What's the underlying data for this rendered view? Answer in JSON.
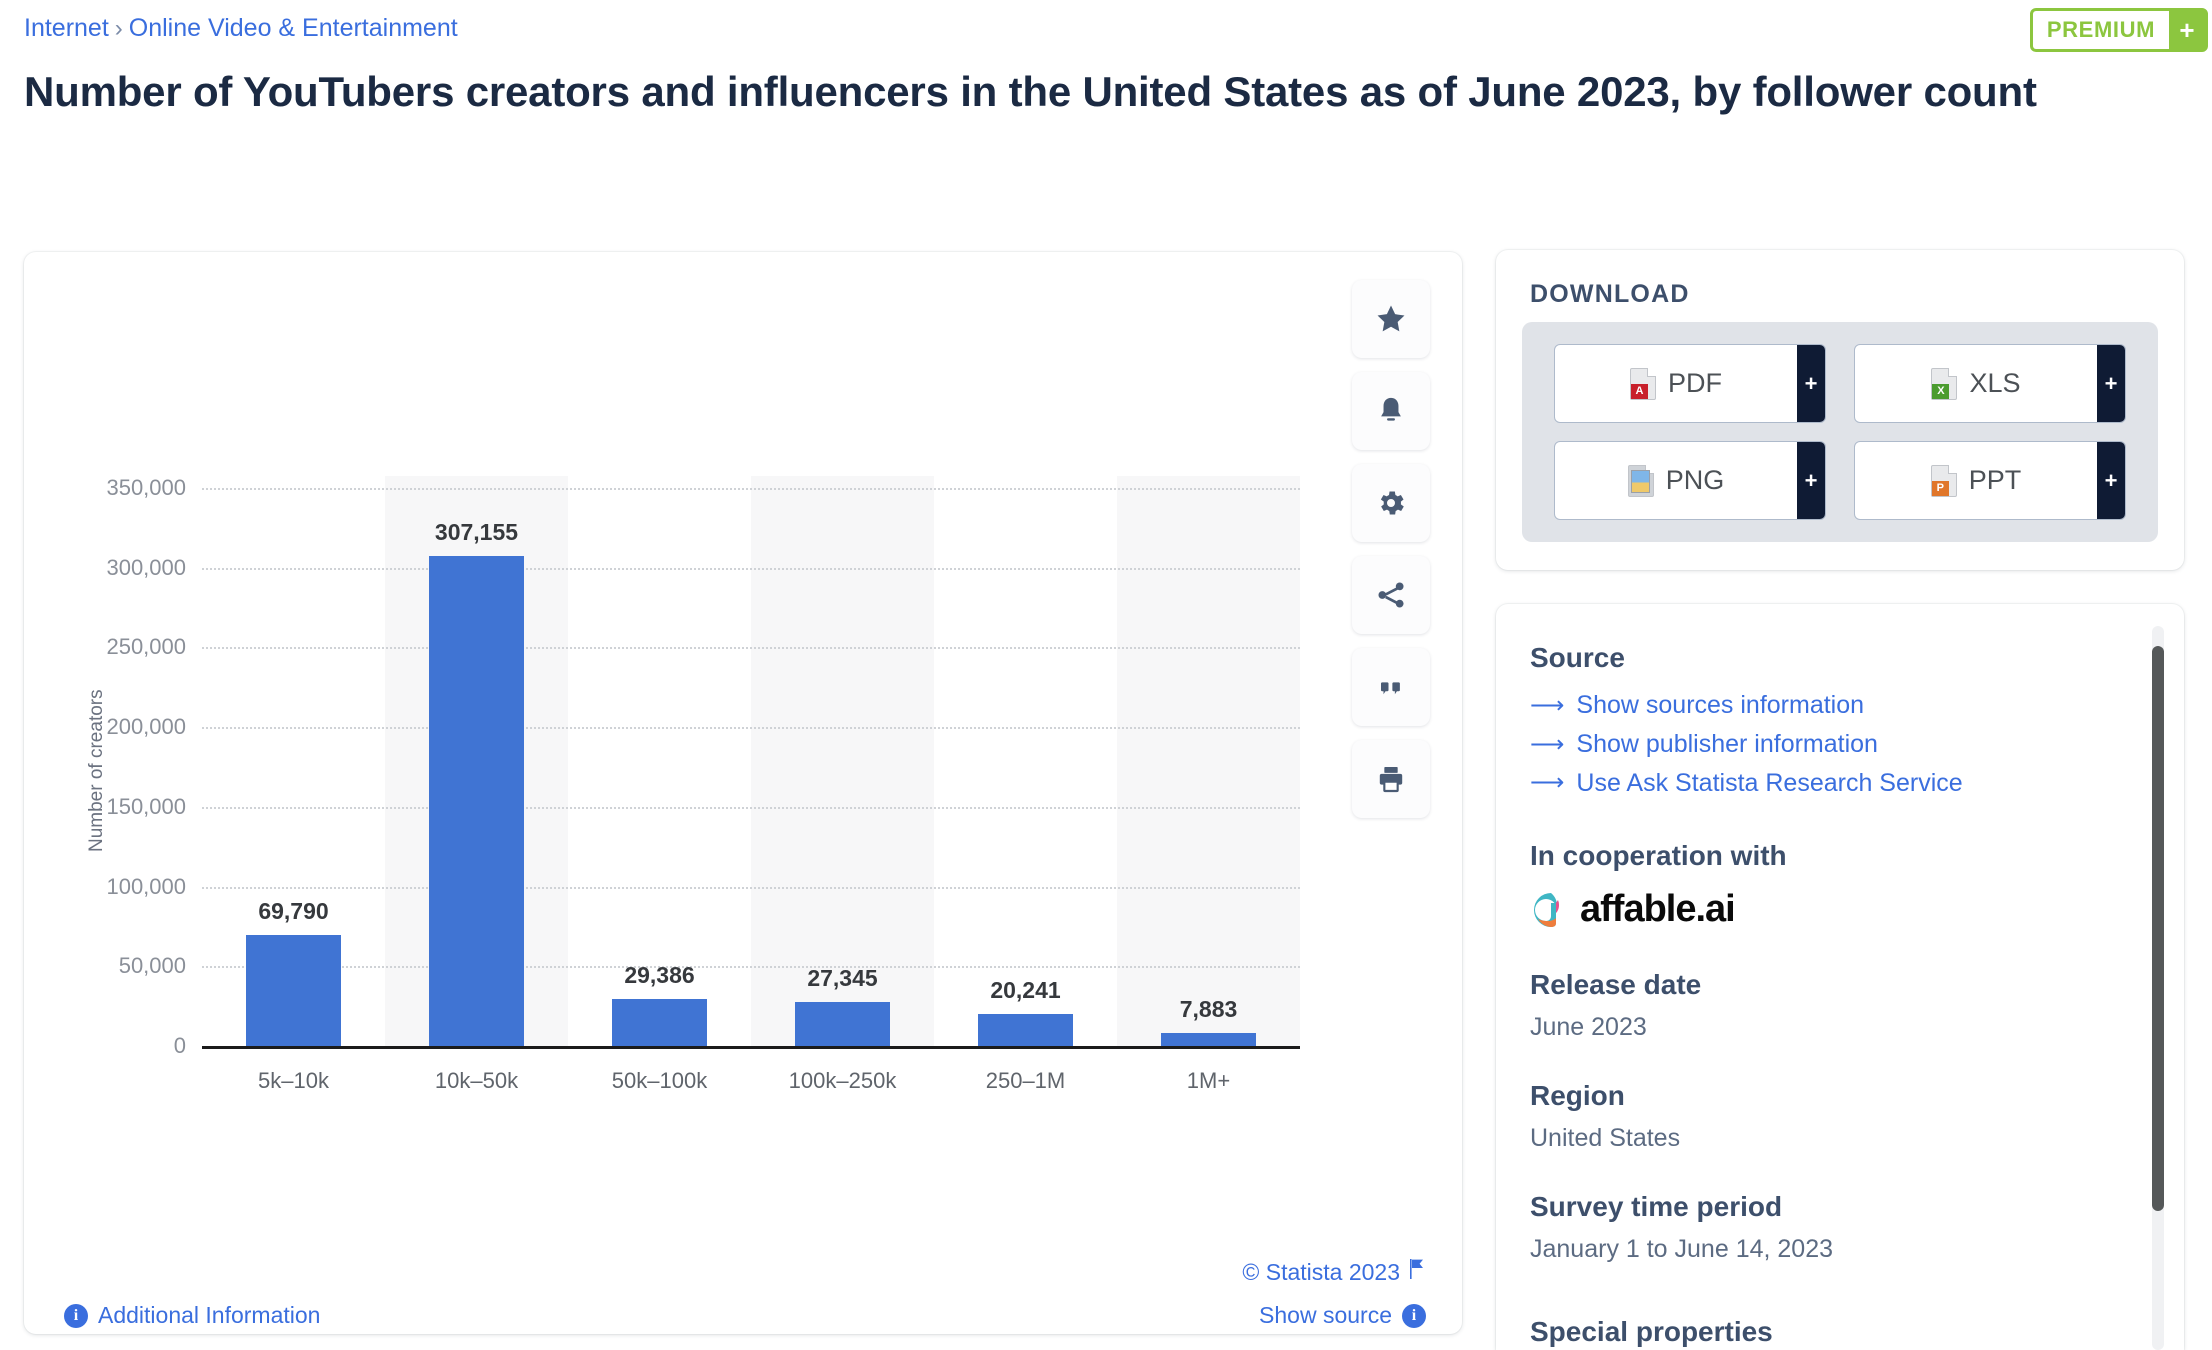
{
  "breadcrumb": {
    "root": "Internet",
    "separator": "›",
    "category": "Online Video & Entertainment"
  },
  "header": {
    "title": "Number of YouTubers creators and influencers in the United States as of June 2023, by follower count",
    "premium_label": "PREMIUM",
    "premium_plus": "+"
  },
  "chart_data": {
    "type": "bar",
    "title": "Number of YouTubers creators and influencers in the United States as of June 2023, by follower count",
    "xlabel": "",
    "ylabel": "Number of creators",
    "categories": [
      "5k–10k",
      "10k–50k",
      "50k–100k",
      "100k–250k",
      "250–1M",
      "1M+"
    ],
    "values": [
      69790,
      307155,
      29386,
      27345,
      20241,
      7883
    ],
    "value_labels": [
      "69,790",
      "307,155",
      "29,386",
      "27,345",
      "20,241",
      "7,883"
    ],
    "ytick_labels": [
      "350,000",
      "300,000",
      "250,000",
      "200,000",
      "150,000",
      "100,000",
      "50,000",
      "0"
    ],
    "ytick_values": [
      350000,
      300000,
      250000,
      200000,
      150000,
      100000,
      50000,
      0
    ],
    "ylim": [
      0,
      350000
    ],
    "grid": true,
    "legend": false,
    "bar_color": "#4074d3"
  },
  "chart_toolbar": [
    {
      "name": "favorite-star-icon",
      "label": "Add to favorites"
    },
    {
      "name": "notification-bell-icon",
      "label": "Notify me"
    },
    {
      "name": "settings-gear-icon",
      "label": "Settings"
    },
    {
      "name": "share-icon",
      "label": "Share"
    },
    {
      "name": "quote-citation-icon",
      "label": "Cite"
    },
    {
      "name": "print-icon",
      "label": "Print"
    }
  ],
  "chart_footer": {
    "copyright": "© Statista 2023",
    "additional_information": "Additional Information",
    "show_source": "Show source"
  },
  "download": {
    "heading": "DOWNLOAD",
    "buttons": [
      {
        "label": "PDF",
        "plus": "+",
        "icon": "pdf-file-icon",
        "color": "#c8202b",
        "tag": "A"
      },
      {
        "label": "XLS",
        "plus": "+",
        "icon": "xls-file-icon",
        "color": "#4b9c2f",
        "tag": "X"
      },
      {
        "label": "PNG",
        "plus": "+",
        "icon": "png-file-icon",
        "color": "#5a8fc0",
        "tag": ""
      },
      {
        "label": "PPT",
        "plus": "+",
        "icon": "ppt-file-icon",
        "color": "#e0762a",
        "tag": "P"
      }
    ]
  },
  "sidebar_info": {
    "source_heading": "Source",
    "source_links": [
      "Show sources information",
      "Show publisher information",
      "Use Ask Statista Research Service"
    ],
    "cooperation_heading": "In cooperation with",
    "partner_logo_text": "affable.ai",
    "release_date_heading": "Release date",
    "release_date_value": "June 2023",
    "region_heading": "Region",
    "region_value": "United States",
    "survey_heading": "Survey time period",
    "survey_value": "January 1 to June 14, 2023",
    "special_heading": "Special properties"
  },
  "colors": {
    "link": "#3a6ede",
    "title": "#1b2a43",
    "bar": "#4074d3",
    "premium_green": "#8cc63f",
    "dark_navy": "#0f1b34"
  }
}
